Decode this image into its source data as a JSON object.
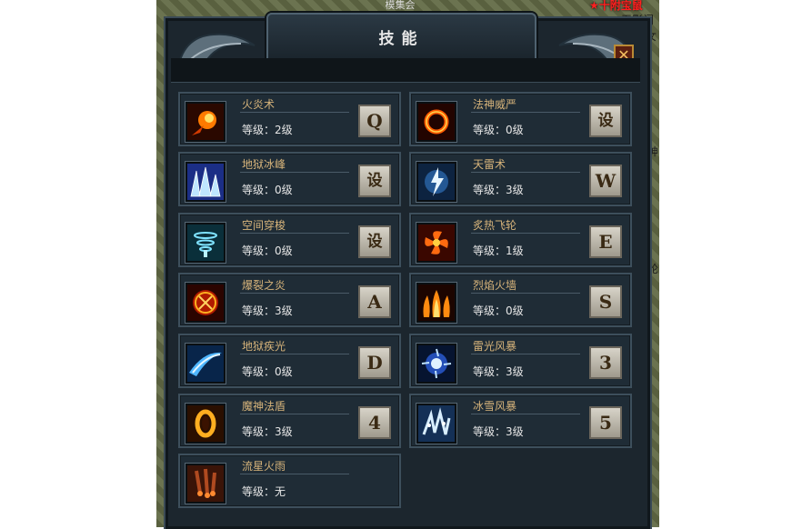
{
  "window": {
    "title": "技能",
    "top_strip_text": "模集会",
    "close_label": "✕"
  },
  "edge_labels": {
    "top_right_red": "★十附宝鼠",
    "right_top": "无影门",
    "right_top2": "女",
    "right_mid1": "神",
    "right_mid2": "轮"
  },
  "skills": [
    {
      "name": "火炎术",
      "level": "等级：2级",
      "key": "Q",
      "icon": "fireball-icon"
    },
    {
      "name": "法神威严",
      "level": "等级：0级",
      "key": "设",
      "icon": "fire-ring-icon"
    },
    {
      "name": "地狱冰峰",
      "level": "等级：0级",
      "key": "设",
      "icon": "ice-spikes-icon"
    },
    {
      "name": "天雷术",
      "level": "等级：3级",
      "key": "W",
      "icon": "thunder-icon"
    },
    {
      "name": "空间穿梭",
      "level": "等级：0级",
      "key": "设",
      "icon": "teleport-vortex-icon"
    },
    {
      "name": "炙热飞轮",
      "level": "等级：1级",
      "key": "E",
      "icon": "flame-wheel-icon"
    },
    {
      "name": "爆裂之炎",
      "level": "等级：3级",
      "key": "A",
      "icon": "explosion-icon"
    },
    {
      "name": "烈焰火墙",
      "level": "等级：0级",
      "key": "S",
      "icon": "fire-wall-icon"
    },
    {
      "name": "地狱疾光",
      "level": "等级：0级",
      "key": "D",
      "icon": "ice-beam-icon"
    },
    {
      "name": "雷光风暴",
      "level": "等级：3级",
      "key": "3",
      "icon": "lightning-storm-icon"
    },
    {
      "name": "魔神法盾",
      "level": "等级：3级",
      "key": "4",
      "icon": "magic-shield-icon"
    },
    {
      "name": "冰雪风暴",
      "level": "等级：3级",
      "key": "5",
      "icon": "blizzard-icon"
    },
    {
      "name": "流星火雨",
      "level": "等级：无",
      "key": "",
      "icon": "meteor-rain-icon"
    }
  ]
}
